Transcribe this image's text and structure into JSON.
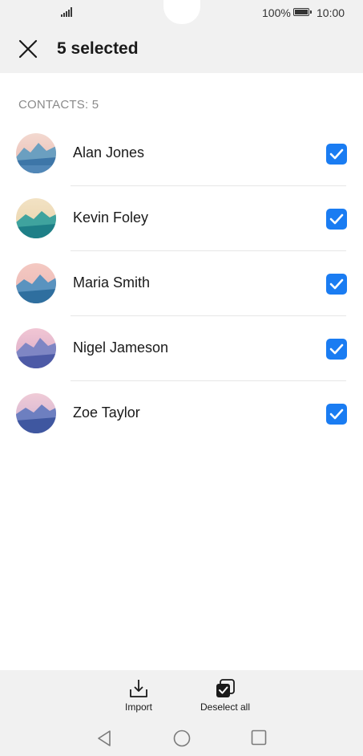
{
  "status_bar": {
    "battery_percent": "100%",
    "time": "10:00",
    "icons": [
      "signal-icon",
      "battery-icon"
    ]
  },
  "header": {
    "close_icon": "close-icon",
    "title": "5 selected"
  },
  "section": {
    "label": "CONTACTS: 5"
  },
  "contacts": [
    {
      "name": "Alan Jones",
      "checked": true
    },
    {
      "name": "Kevin Foley",
      "checked": true
    },
    {
      "name": "Maria Smith",
      "checked": true
    },
    {
      "name": "Nigel Jameson",
      "checked": true
    },
    {
      "name": "Zoe Taylor",
      "checked": true
    }
  ],
  "actions": {
    "import_label": "Import",
    "import_icon": "import-icon",
    "deselect_label": "Deselect all",
    "deselect_icon": "deselect-all-icon"
  },
  "nav": {
    "icons": [
      "back-icon",
      "home-icon",
      "recents-icon"
    ]
  },
  "colors": {
    "accent": "#1a7cf2",
    "background": "#f1f1f1",
    "surface": "#ffffff",
    "secondary_text": "#8a8a8a"
  }
}
